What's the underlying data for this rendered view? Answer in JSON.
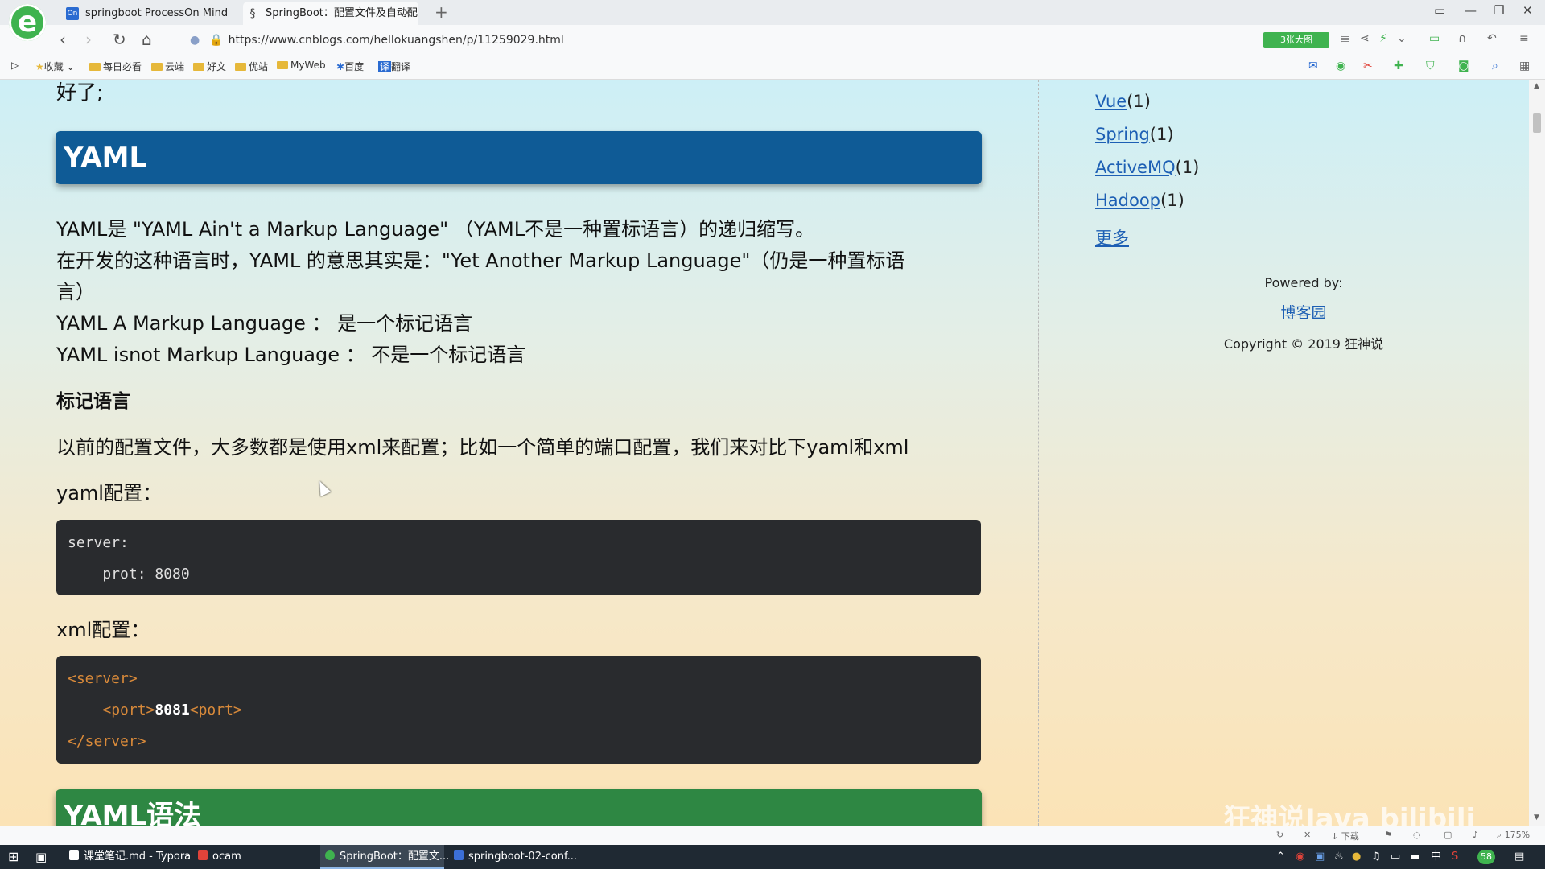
{
  "browser": {
    "tabs": [
      {
        "icon": "On",
        "title": "springboot ProcessOn Mind"
      },
      {
        "icon": "§",
        "title": "SpringBoot：配置文件及自动配",
        "close": "×"
      }
    ],
    "new_tab": "+",
    "url": "https://www.cnblogs.com/hellokuangshen/p/11259029.html",
    "big_image_button": "3张大图",
    "window_controls": [
      "▭",
      "—",
      "❐",
      "✕"
    ]
  },
  "bookmarks": [
    "收藏",
    "每日必看",
    "云端",
    "好文",
    "优站",
    "MyWeb",
    "百度",
    "翻译"
  ],
  "article": {
    "prev_text": "好了;",
    "yaml_heading": "YAML",
    "intro_lines": [
      "YAML是 \"YAML Ain't a Markup Language\" （YAML不是一种置标语言）的递归缩写。",
      "在开发的这种语言时，YAML 的意思其实是：\"Yet Another Markup Language\"（仍是一种置标语",
      "言）",
      "YAML A Markup Language ： 是一个标记语言",
      "YAML isnot Markup Language ： 不是一个标记语言"
    ],
    "markup_heading": "标记语言",
    "compare_text": " 以前的配置文件，大多数都是使用xml来配置；比如一个简单的端口配置，我们来对比下yaml和xml",
    "yaml_label": "yaml配置：",
    "yaml_code": [
      "server:",
      "    prot: 8080"
    ],
    "xml_label": "xml配置：",
    "xml_code": {
      "open": "<server>",
      "port_open": "<port>",
      "port_value": "8081",
      "port_close": "<port>",
      "close": "</server>"
    },
    "syntax_heading": "YAML语法"
  },
  "sidebar": {
    "categories": [
      {
        "name": "Vue",
        "count": "(1)"
      },
      {
        "name": "Spring",
        "count": "(1)"
      },
      {
        "name": "ActiveMQ",
        "count": "(1)"
      },
      {
        "name": "Hadoop",
        "count": "(1)"
      }
    ],
    "more": "更多",
    "powered_by": "Powered by:",
    "powered_link": "博客园",
    "copyright": "Copyright © 2019 狂神说"
  },
  "statusbar": {
    "download": "下载",
    "zoom": "175%"
  },
  "watermark": "狂神说Java bilibili",
  "taskbar": {
    "apps": [
      {
        "label": "课堂笔记.md - Typora",
        "color": "#ffffff"
      },
      {
        "label": "ocam",
        "color": "#e0433a"
      },
      {
        "label": "SpringBoot：配置文...",
        "color": "#3fb34f"
      },
      {
        "label": "springboot-02-conf...",
        "color": "#3c6fd6"
      }
    ],
    "ime": "中",
    "badge": "58"
  }
}
